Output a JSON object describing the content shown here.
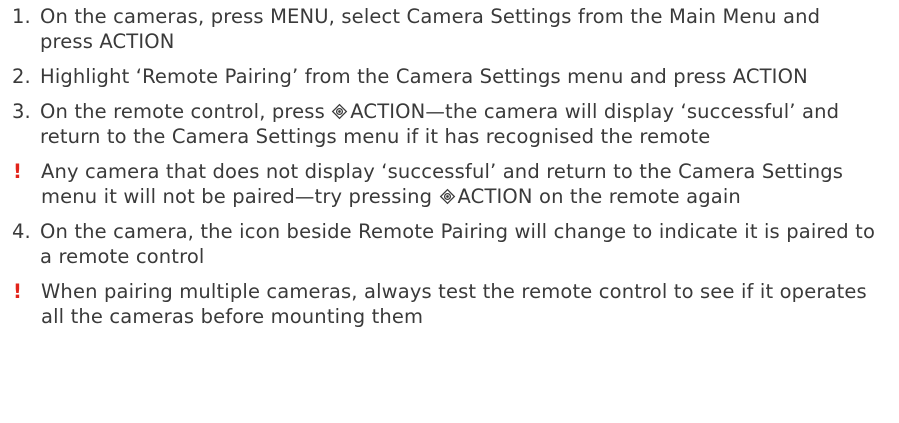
{
  "steps": [
    {
      "marker": "1.",
      "type": "numbered",
      "text": "On the cameras, press MENU, select Camera Settings from the Main Menu and press ACTION"
    },
    {
      "marker": "2.",
      "type": "numbered",
      "text": "Highlight ‘Remote Pairing’ from the Camera Settings menu and press ACTION"
    },
    {
      "marker": "3.",
      "type": "numbered",
      "text_before": "On the remote control, press ",
      "icon": "action-button-icon",
      "text_after": "ACTION—the camera will display ‘successful’ and return to the Camera Settings menu if it has recognised the remote"
    },
    {
      "marker": "!",
      "type": "warning",
      "text_before": "Any camera that does not display ‘successful’ and return to the Camera Settings menu it will not be paired—try pressing ",
      "icon": "action-button-icon",
      "text_after": "ACTION on the remote again"
    },
    {
      "marker": "4.",
      "type": "numbered",
      "text": "On the camera, the icon beside Remote Pairing will change to indicate it is paired to a remote control"
    },
    {
      "marker": "!",
      "type": "warning",
      "text": "When pairing multiple cameras, always test the remote control to see if it operates all the cameras before mounting them"
    }
  ],
  "colors": {
    "text": "#3a3a3a",
    "warning_marker": "#e2231a"
  }
}
